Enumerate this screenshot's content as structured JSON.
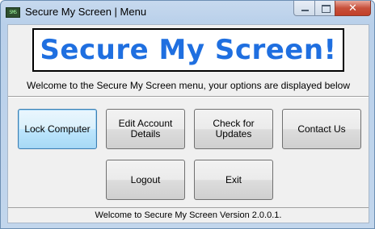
{
  "window": {
    "title": "Secure My Screen | Menu",
    "icon": "app-icon",
    "icon_text": "SMS"
  },
  "banner": {
    "text": "Secure My Screen!",
    "color": "#1f6fe0"
  },
  "welcome_text": "Welcome to the Secure My Screen menu, your options are displayed below",
  "buttons": {
    "lock": "Lock Computer",
    "edit_account": "Edit Account Details",
    "check_updates": "Check for Updates",
    "contact": "Contact Us",
    "logout": "Logout",
    "exit": "Exit"
  },
  "status": "Welcome to Secure My Screen Version 2.0.0.1."
}
